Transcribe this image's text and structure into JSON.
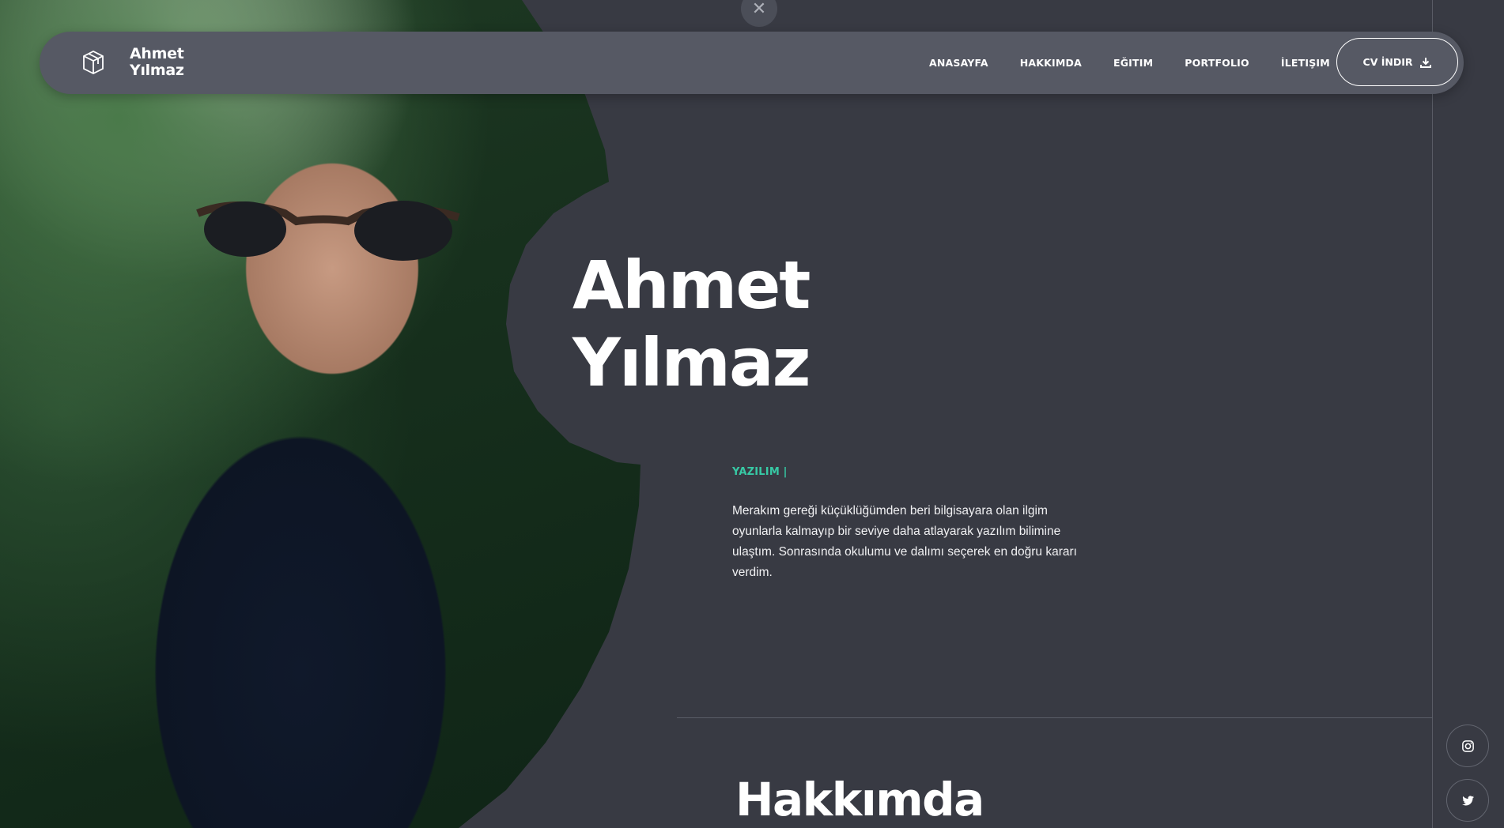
{
  "brand": {
    "name": "Ahmet Yılmaz",
    "logo_icon": "box-icon"
  },
  "nav": {
    "items": [
      {
        "label": "ANASAYFA"
      },
      {
        "label": "HAKKIMDA"
      },
      {
        "label": "EĞITIM"
      },
      {
        "label": "PORTFOLIO"
      },
      {
        "label": "İLETIŞIM"
      }
    ],
    "cv_button": {
      "label": "CV İNDIR",
      "icon": "download-icon"
    }
  },
  "overlay": {
    "close_icon": "close-icon"
  },
  "hero": {
    "name_line1": "Ahmet",
    "name_line2": "Yılmaz",
    "role": "YAZILIM |",
    "bio": "Merakım gereği küçüklüğümden beri bilgisayara olan ilgim oyunlarla kalmayıp bir seviye daha atlayarak yazılım bilimine ulaştım. Sonrasında okulumu ve dalımı seçerek en doğru kararı verdim."
  },
  "about": {
    "title": "Hakkımda"
  },
  "social": [
    {
      "name": "instagram",
      "icon": "instagram-icon"
    },
    {
      "name": "twitter",
      "icon": "twitter-icon"
    }
  ],
  "colors": {
    "background": "#383a43",
    "navbar": "#565964",
    "accent": "#37c9a5",
    "text": "#ffffff"
  }
}
